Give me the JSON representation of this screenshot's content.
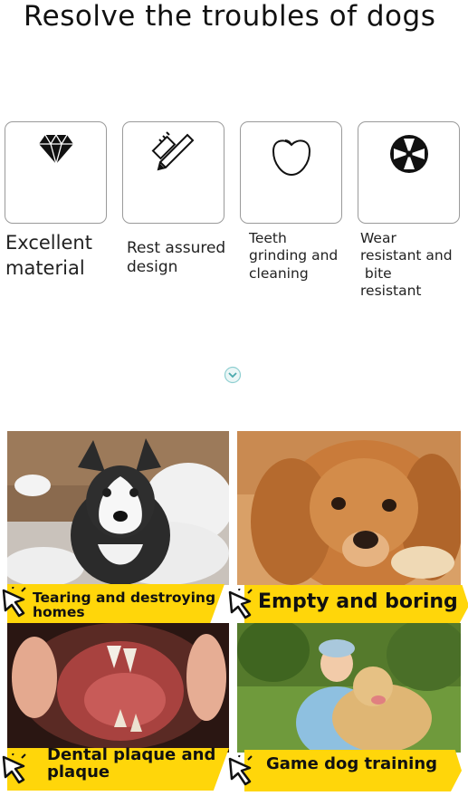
{
  "title": "Resolve the troubles of dogs",
  "features": [
    {
      "label_1": "Excellent",
      "label_2": "material",
      "icon": "diamond-icon"
    },
    {
      "label_1": "Rest assured",
      "label_2": "design",
      "icon": "pencil-ruler-icon"
    },
    {
      "label_1": "Teeth",
      "label_2": "grinding and",
      "label_3": "cleaning",
      "icon": "tooth-icon"
    },
    {
      "label_1": "Wear",
      "label_2": "resistant and",
      "label_3": " bite",
      "label_4": "resistant",
      "icon": "fan-icon"
    }
  ],
  "expand_icon": "chevron-down-icon",
  "panels": [
    {
      "caption_1": "Tearing and destroying",
      "caption_2": "homes",
      "image": "husky-with-torn-stuffing"
    },
    {
      "caption_1": "Empty and boring",
      "image": "golden-retriever-lying"
    },
    {
      "caption_1": "Dental plaque and",
      "caption_2": "plaque",
      "image": "dog-teeth-closeup"
    },
    {
      "caption_1": "Game dog training",
      "image": "boy-with-golden-retriever"
    }
  ],
  "colors": {
    "caption_bar": "#ffd60a",
    "box_border": "#9a9a9a"
  }
}
